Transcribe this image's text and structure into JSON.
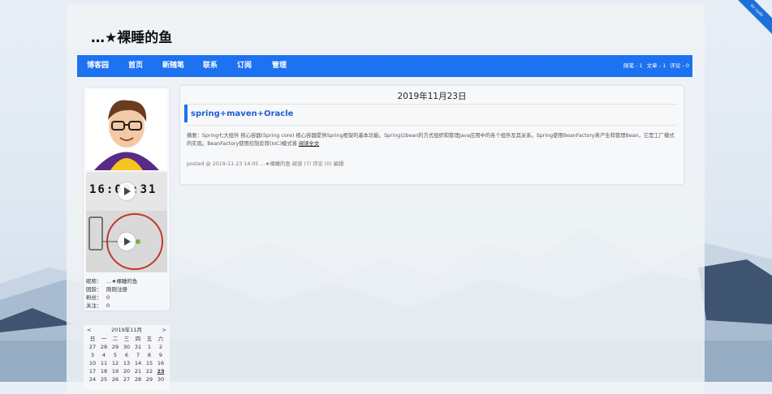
{
  "blog": {
    "title": "…★裸睡的鱼"
  },
  "ribbon": {
    "text": "ev code"
  },
  "nav": {
    "items": [
      "博客园",
      "首页",
      "新随笔",
      "联系",
      "订阅",
      "管理"
    ],
    "stats": [
      "随笔 - 1",
      "文章 - 1",
      "评论 - 0"
    ]
  },
  "profile": {
    "rows": [
      {
        "label": "昵称：",
        "value": "…★裸睡的鱼"
      },
      {
        "label": "园龄：",
        "value": "刚刚注册"
      },
      {
        "label": "粉丝：",
        "value": "0"
      },
      {
        "label": "关注：",
        "value": "0"
      }
    ],
    "video_clock_text": "16:00:31"
  },
  "calendar": {
    "title": "2019年11月",
    "prev": "<",
    "next": ">",
    "weekdays": [
      "日",
      "一",
      "二",
      "三",
      "四",
      "五",
      "六"
    ],
    "days": [
      "27",
      "28",
      "29",
      "30",
      "31",
      "1",
      "2",
      "3",
      "4",
      "5",
      "6",
      "7",
      "8",
      "9",
      "10",
      "11",
      "12",
      "13",
      "14",
      "15",
      "16",
      "17",
      "18",
      "19",
      "20",
      "21",
      "22",
      "23",
      "24",
      "25",
      "26",
      "27",
      "28",
      "29",
      "30"
    ],
    "today": "23"
  },
  "post": {
    "date": "2019年11月23日",
    "title": "spring+maven+Oracle",
    "summary": "摘要：Spring七大组件 核心容器(Spring core) 核心容器提供Spring框架的基本功能。Spring以bean的方式组织和管理Java应用中的各个组件及其关系。Spring使用BeanFactory来产生和管理Bean，它是工厂模式的实现。BeanFactory使用控制反转(IoC)模式将",
    "read_more": "阅读全文",
    "footer": "posted @ 2019-11-23 14:05 …★裸睡的鱼 阅读 (7) 评论 (0) 编辑"
  }
}
